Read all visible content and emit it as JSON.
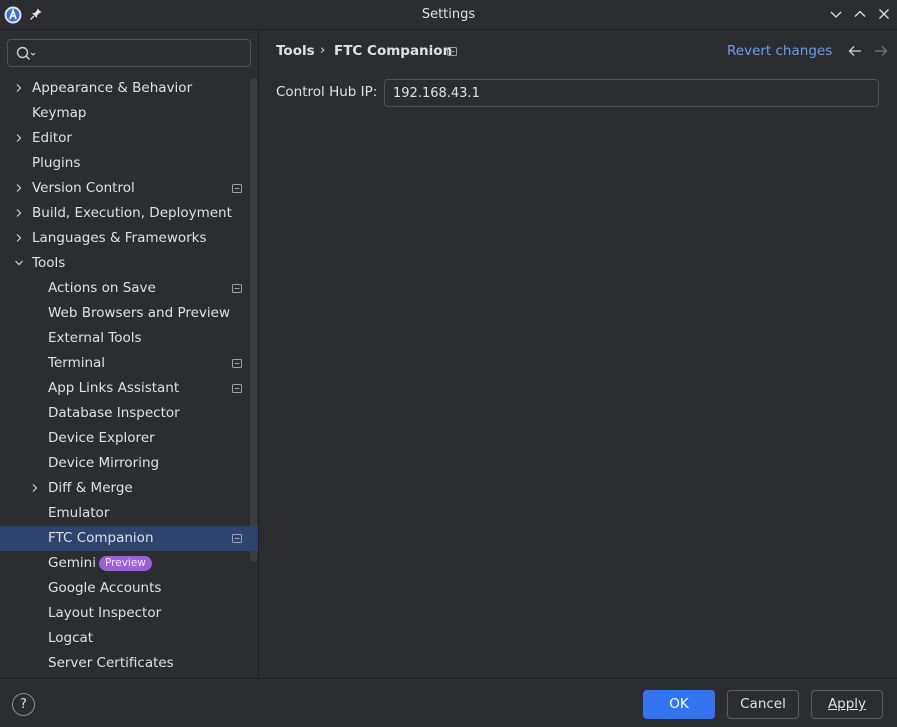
{
  "window": {
    "title": "Settings"
  },
  "sidebar": {
    "search": {
      "placeholder": "",
      "value": ""
    },
    "items": [
      {
        "label": "Appearance & Behavior",
        "level": 1,
        "expandable": true,
        "expanded": false,
        "project_icon": false,
        "bold": true
      },
      {
        "label": "Keymap",
        "level": 1,
        "expandable": false,
        "project_icon": false,
        "bold": true
      },
      {
        "label": "Editor",
        "level": 1,
        "expandable": true,
        "expanded": false,
        "project_icon": false,
        "bold": true
      },
      {
        "label": "Plugins",
        "level": 1,
        "expandable": false,
        "project_icon": false,
        "bold": true
      },
      {
        "label": "Version Control",
        "level": 1,
        "expandable": true,
        "expanded": false,
        "project_icon": true,
        "bold": true
      },
      {
        "label": "Build, Execution, Deployment",
        "level": 1,
        "expandable": true,
        "expanded": false,
        "project_icon": false,
        "bold": true
      },
      {
        "label": "Languages & Frameworks",
        "level": 1,
        "expandable": true,
        "expanded": false,
        "project_icon": false,
        "bold": true
      },
      {
        "label": "Tools",
        "level": 1,
        "expandable": true,
        "expanded": true,
        "project_icon": false,
        "bold": true
      },
      {
        "label": "Actions on Save",
        "level": 2,
        "expandable": false,
        "project_icon": true
      },
      {
        "label": "Web Browsers and Preview",
        "level": 2,
        "expandable": false,
        "project_icon": false
      },
      {
        "label": "External Tools",
        "level": 2,
        "expandable": false,
        "project_icon": false
      },
      {
        "label": "Terminal",
        "level": 2,
        "expandable": false,
        "project_icon": true
      },
      {
        "label": "App Links Assistant",
        "level": 2,
        "expandable": false,
        "project_icon": true
      },
      {
        "label": "Database Inspector",
        "level": 2,
        "expandable": false,
        "project_icon": false
      },
      {
        "label": "Device Explorer",
        "level": 2,
        "expandable": false,
        "project_icon": false
      },
      {
        "label": "Device Mirroring",
        "level": 2,
        "expandable": false,
        "project_icon": false
      },
      {
        "label": "Diff & Merge",
        "level": 2,
        "expandable": true,
        "expanded": false,
        "project_icon": false
      },
      {
        "label": "Emulator",
        "level": 2,
        "expandable": false,
        "project_icon": false
      },
      {
        "label": "FTC Companion",
        "level": 2,
        "expandable": false,
        "project_icon": true,
        "selected": true
      },
      {
        "label": "Gemini",
        "level": 2,
        "expandable": false,
        "project_icon": false,
        "badge": "Preview"
      },
      {
        "label": "Google Accounts",
        "level": 2,
        "expandable": false,
        "project_icon": false
      },
      {
        "label": "Layout Inspector",
        "level": 2,
        "expandable": false,
        "project_icon": false
      },
      {
        "label": "Logcat",
        "level": 2,
        "expandable": false,
        "project_icon": false
      },
      {
        "label": "Server Certificates",
        "level": 2,
        "expandable": false,
        "project_icon": false
      }
    ]
  },
  "content": {
    "breadcrumb": {
      "parent": "Tools",
      "separator": "›",
      "current": "FTC Companion"
    },
    "revert_label": "Revert changes",
    "fields": [
      {
        "label": "Control Hub IP:",
        "value": "192.168.43.1"
      }
    ]
  },
  "footer": {
    "help_label": "?",
    "ok_label": "OK",
    "cancel_label": "Cancel",
    "apply_label": "Apply"
  },
  "colors": {
    "background": "#2b2d30",
    "selection": "#2e436e",
    "accent_button": "#3574f0",
    "link": "#6c9ee8",
    "badge": "#9b5fd6",
    "text": "#dfe1e5"
  }
}
